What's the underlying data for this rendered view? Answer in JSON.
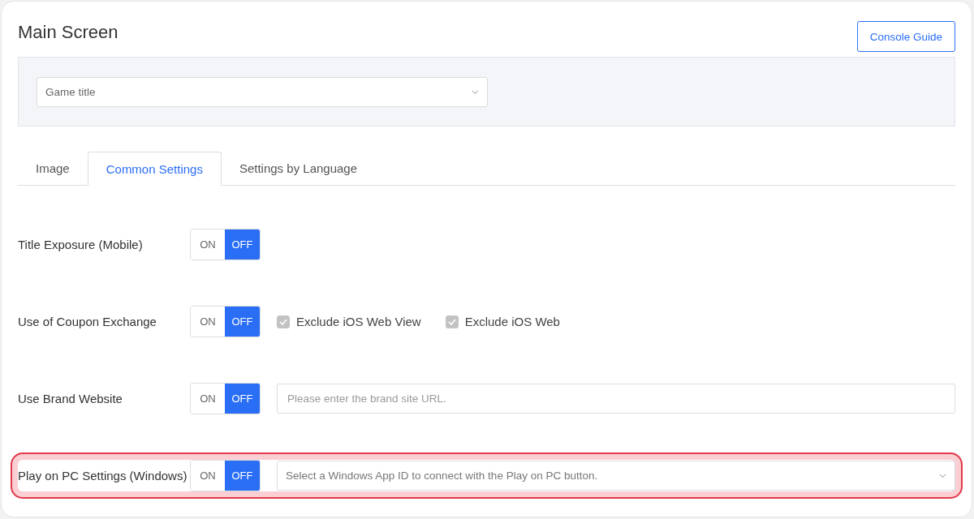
{
  "page": {
    "title": "Main Screen",
    "guide_button": "Console Guide"
  },
  "game_select": {
    "placeholder": "Game title"
  },
  "tabs": [
    {
      "label": "Image",
      "selected": false
    },
    {
      "label": "Common Settings",
      "selected": true
    },
    {
      "label": "Settings by Language",
      "selected": false
    }
  ],
  "settings": [
    {
      "kind": "plain",
      "label": "Title Exposure (Mobile)",
      "on_label": "ON",
      "off_label": "OFF",
      "on": false,
      "highlighted": false
    },
    {
      "kind": "checkboxes",
      "label": "Use of Coupon Exchange",
      "on_label": "ON",
      "off_label": "OFF",
      "on": false,
      "highlighted": false,
      "options": [
        {
          "label": "Exclude iOS Web View",
          "checked": true,
          "disabled": true
        },
        {
          "label": "Exclude iOS Web",
          "checked": true,
          "disabled": true
        }
      ]
    },
    {
      "kind": "input",
      "label": "Use Brand Website",
      "on_label": "ON",
      "off_label": "OFF",
      "on": false,
      "highlighted": false,
      "placeholder": "Please enter the brand site URL."
    },
    {
      "kind": "select",
      "label": "Play on PC Settings (Windows)",
      "on_label": "ON",
      "off_label": "OFF",
      "on": false,
      "highlighted": true,
      "placeholder": "Select a Windows App ID to connect with the Play on PC button."
    }
  ]
}
